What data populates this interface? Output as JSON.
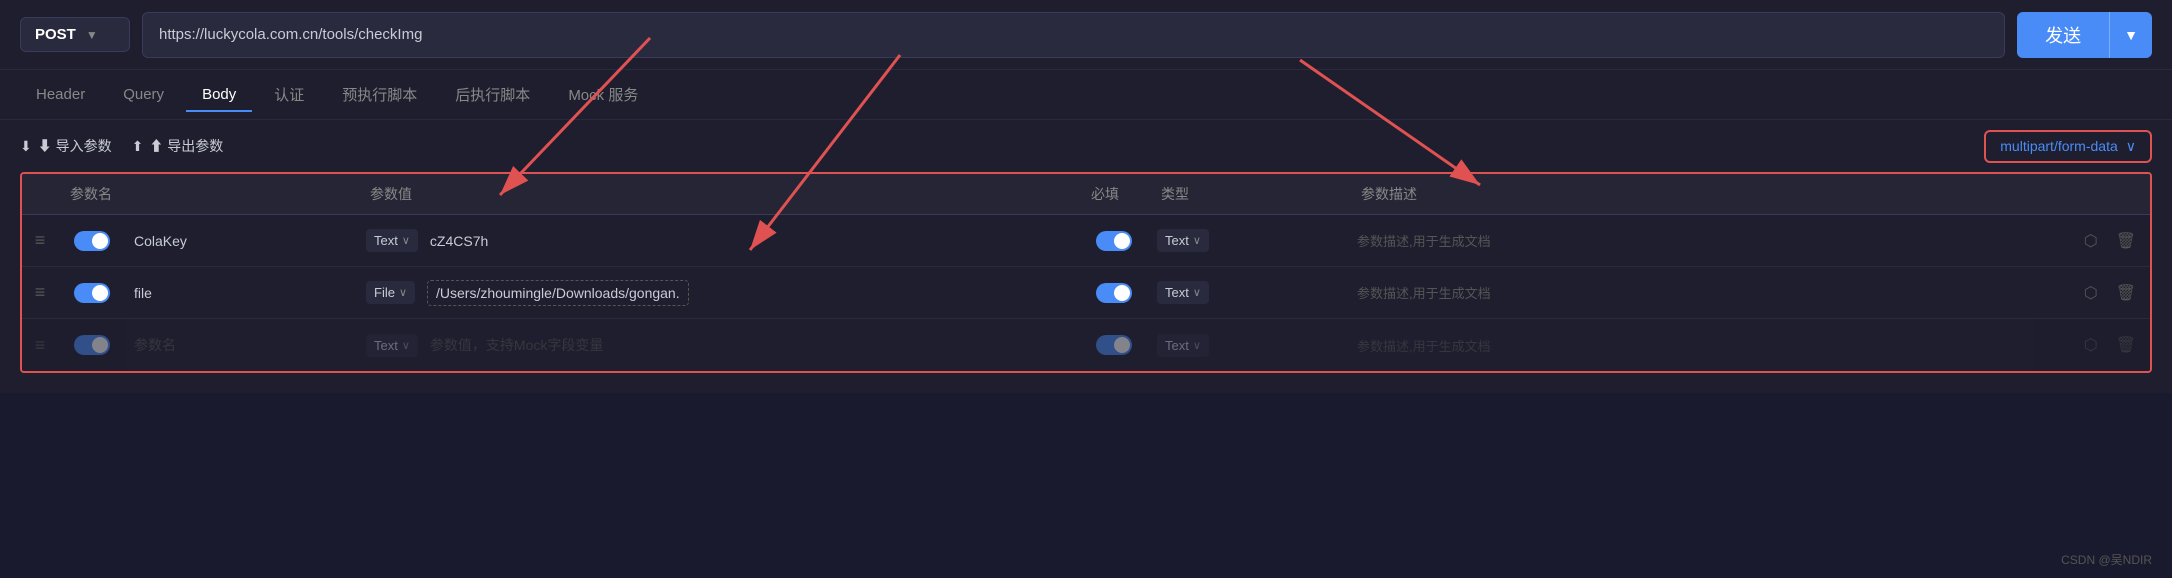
{
  "method": {
    "label": "POST",
    "chevron": "▼"
  },
  "url": {
    "value": "https://luckycola.com.cn/tools/checkImg"
  },
  "send_button": {
    "label": "发送",
    "chevron": "▼"
  },
  "tabs": [
    {
      "label": "Header",
      "active": false
    },
    {
      "label": "Query",
      "active": false
    },
    {
      "label": "Body",
      "active": true
    },
    {
      "label": "认证",
      "active": false
    },
    {
      "label": "预执行脚本",
      "active": false
    },
    {
      "label": "后执行脚本",
      "active": false
    },
    {
      "label": "Mock 服务",
      "active": false
    }
  ],
  "actions": {
    "import": "⬇ 导入参数",
    "export": "⬆ 导出参数"
  },
  "format_selector": {
    "label": "multipart/form-data",
    "chevron": "∨"
  },
  "table": {
    "headers": [
      "",
      "参数名",
      "参数值",
      "必填",
      "类型",
      "参数描述",
      ""
    ],
    "rows": [
      {
        "enabled": true,
        "name": "ColaKey",
        "type": "Text",
        "value": "cZ4CS7h",
        "required": true,
        "value_type": "Text",
        "desc": "参数描述,用于生成文档",
        "dashed": false
      },
      {
        "enabled": true,
        "name": "file",
        "type": "File",
        "value": "/Users/zhoumingle/Downloads/gongan.",
        "required": true,
        "value_type": "Text",
        "desc": "参数描述,用于生成文档",
        "dashed": true
      },
      {
        "enabled": true,
        "name": "参数名",
        "type": "Text",
        "value": "参数值，支持Mock字段变量",
        "required": true,
        "value_type": "Text",
        "desc": "参数描述,用于生成文档",
        "dashed": false,
        "placeholder": true
      }
    ]
  },
  "watermark": "CSDN @吴NDIR"
}
